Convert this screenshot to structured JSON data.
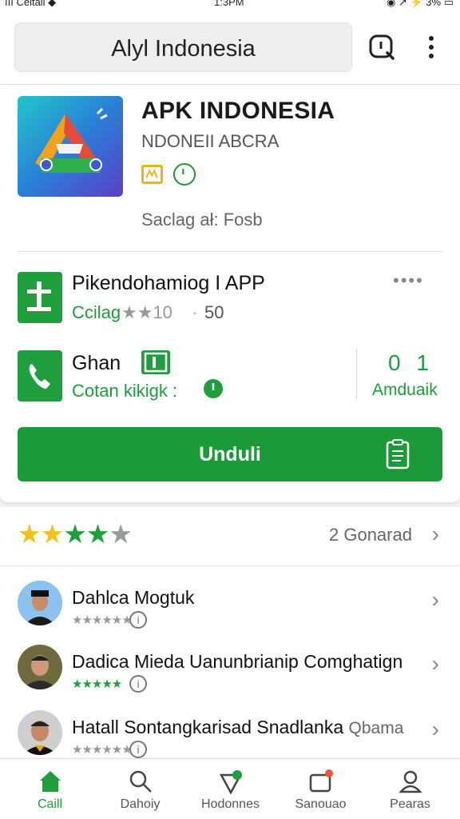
{
  "status_bar": {
    "left": "ııı Celtall ◆",
    "time": "1:3PM",
    "right": "◉ ↗ ⚡ 3% ▭"
  },
  "header": {
    "search_text": "Alyl Indonesia",
    "search_icon": "search-icon",
    "more_icon": "more-vert-icon"
  },
  "app": {
    "title": "APK INDONESIA",
    "subtitle": "NDONEII ABCRA",
    "meta": "Saclag ał: Fosb",
    "colors": {
      "green": "#1e9e3d",
      "badge_yellow": "#f2b21b"
    }
  },
  "rows": [
    {
      "title": "Pikendohamiog I APP",
      "sub": "Ccilag",
      "stars": "★★10",
      "dot": "·",
      "count": "50",
      "more": "••••"
    },
    {
      "title": "Ghan",
      "sub": "Cotan kikigk :",
      "stat_num": "0 1",
      "stat_label": "Amduaik"
    }
  ],
  "download": {
    "label": "Unduli"
  },
  "ratings": {
    "stars": "★★★★★",
    "filled": 4,
    "count_label": "2 Gonarad",
    "chevron": "›"
  },
  "reviews": [
    {
      "name": "Dahlca Mogtuk",
      "stars": "★★★★★★",
      "info": "i",
      "chevron": "›"
    },
    {
      "name": "Dadica Mieda Uanunbrianip Comghatign",
      "stars": "★★★★★",
      "info": "i",
      "chevron": "›"
    },
    {
      "name": "Hatall Sontangkarisad Snadlanka",
      "tag": "Qbama",
      "stars": "★★★★★★",
      "info": "i",
      "chevron": "›"
    }
  ],
  "bottom_nav": [
    {
      "label": "Caill",
      "icon": "home-icon",
      "active": true
    },
    {
      "label": "Dahoiy",
      "icon": "search-icon",
      "active": false
    },
    {
      "label": "Hodonnes",
      "icon": "gift-icon",
      "active": false
    },
    {
      "label": "Sanouao",
      "icon": "inbox-icon",
      "active": false
    },
    {
      "label": "Pearas",
      "icon": "person-icon",
      "active": false
    }
  ]
}
